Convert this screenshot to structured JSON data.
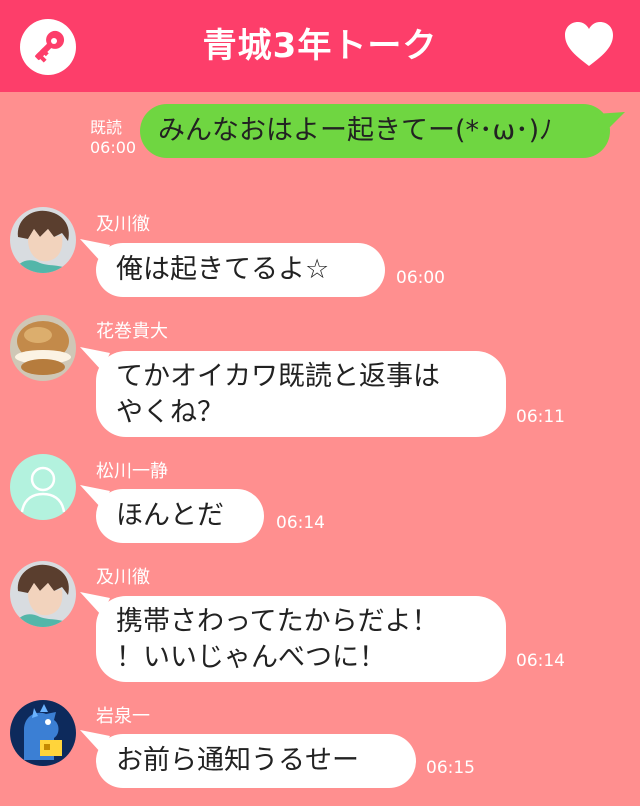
{
  "header": {
    "title": "青城3年トーク",
    "key_icon": "key-icon",
    "heart_icon": "heart-icon",
    "bg": "#fd3e6a"
  },
  "sent": {
    "read_label": "既読",
    "time": "06:00",
    "text": "みんなおはよー起きてー(*･ω･)ﾉ",
    "bubble_color": "#6fd641"
  },
  "messages": [
    {
      "sender": "及川徹",
      "text": "俺は起きてるよ☆",
      "time": "06:00",
      "avatar": "oikawa-avatar"
    },
    {
      "sender": "花巻貴大",
      "text": "てかオイカワ既読と返事は\nやくね？",
      "time": "06:11",
      "avatar": "cream-puff-avatar"
    },
    {
      "sender": "松川一静",
      "text": "ほんとだ",
      "time": "06:14",
      "avatar": "default-person-avatar"
    },
    {
      "sender": "及川徹",
      "text": "携帯さわってたからだよ！\n！いいじゃんべつに！",
      "time": "06:14",
      "avatar": "oikawa-avatar"
    },
    {
      "sender": "岩泉一",
      "text": "お前ら通知うるせー",
      "time": "06:15",
      "avatar": "godzilla-avatar"
    }
  ],
  "colors": {
    "background": "#ff8f8f",
    "bubble": "#ffffff"
  }
}
